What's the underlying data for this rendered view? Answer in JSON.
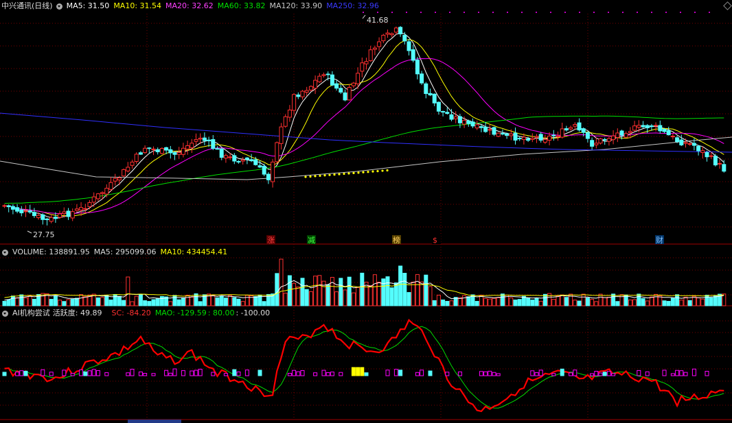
{
  "main_panel": {
    "stock_name": "中兴通讯(日线)",
    "indicators": [
      {
        "label": "MA5: 31.50",
        "color": "#ffffff"
      },
      {
        "label": "MA10: 31.54",
        "color": "#ffff00"
      },
      {
        "label": "MA20: 32.62",
        "color": "#ff00ff"
      },
      {
        "label": "MA60: 33.82",
        "color": "#00e000"
      },
      {
        "label": "MA120: 33.90",
        "color": "#c8c8c8"
      },
      {
        "label": "MA250: 32.96",
        "color": "#3a3aff"
      }
    ],
    "high_label": "41.68",
    "low_label": "27.75",
    "event_markers": [
      {
        "text": "涨",
        "color": "#ff4040",
        "bg": "#550000"
      },
      {
        "text": "减",
        "color": "#40ff40",
        "bg": "#004400"
      },
      {
        "text": "榜",
        "color": "#ffd060",
        "bg": "#554000"
      },
      {
        "text": "$",
        "color": "#ff3030",
        "bg": "#000000"
      },
      {
        "text": "财",
        "color": "#80c0ff",
        "bg": "#003366"
      }
    ]
  },
  "volume_panel": {
    "title": "VOLUME: 138891.95",
    "ma5": "MA5: 295099.06",
    "ma10": "MA10: 434454.41"
  },
  "indicator_panel": {
    "title": "AI机构尝试",
    "activity": "活跃度: 49.89",
    "sc": "SC: -84.20",
    "mao": "MAO: -129.59",
    "level1": ": 80.00",
    "level2": ": -100.00"
  },
  "colors": {
    "up": "#ff3030",
    "down": "#54fcfc",
    "grid": "#8b0000",
    "sc_line": "#ff0000",
    "mao_line": "#00dd00",
    "bar_magenta": "#ff00ff",
    "bar_yellow": "#ffff00"
  }
}
